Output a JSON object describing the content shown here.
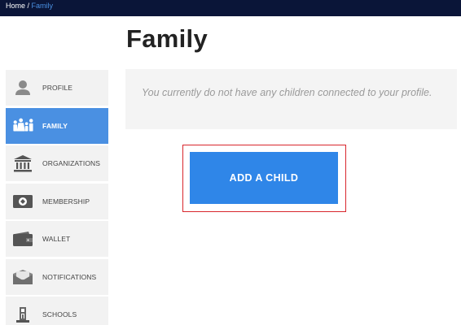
{
  "breadcrumb": {
    "home": "Home",
    "separator": " / ",
    "current": "Family"
  },
  "page": {
    "title": "Family"
  },
  "sidebar": {
    "items": [
      {
        "label": "PROFILE",
        "icon": "person-icon",
        "active": false
      },
      {
        "label": "FAMILY",
        "icon": "family-icon",
        "active": true
      },
      {
        "label": "ORGANIZATIONS",
        "icon": "institution-icon",
        "active": false
      },
      {
        "label": "MEMBERSHIP",
        "icon": "membership-card-icon",
        "active": false
      },
      {
        "label": "WALLET",
        "icon": "wallet-icon",
        "active": false
      },
      {
        "label": "NOTIFICATIONS",
        "icon": "envelope-icon",
        "active": false
      },
      {
        "label": "SCHOOLS",
        "icon": "school-building-icon",
        "active": false
      }
    ]
  },
  "main": {
    "empty_message": "You currently do not have any children connected to your profile.",
    "add_child_label": "ADD A CHILD"
  },
  "colors": {
    "topbar": "#0a1538",
    "accent": "#4a90e2",
    "button": "#2f86e8",
    "highlight_border": "#d8262c",
    "sidebar_bg": "#f2f2f2"
  }
}
